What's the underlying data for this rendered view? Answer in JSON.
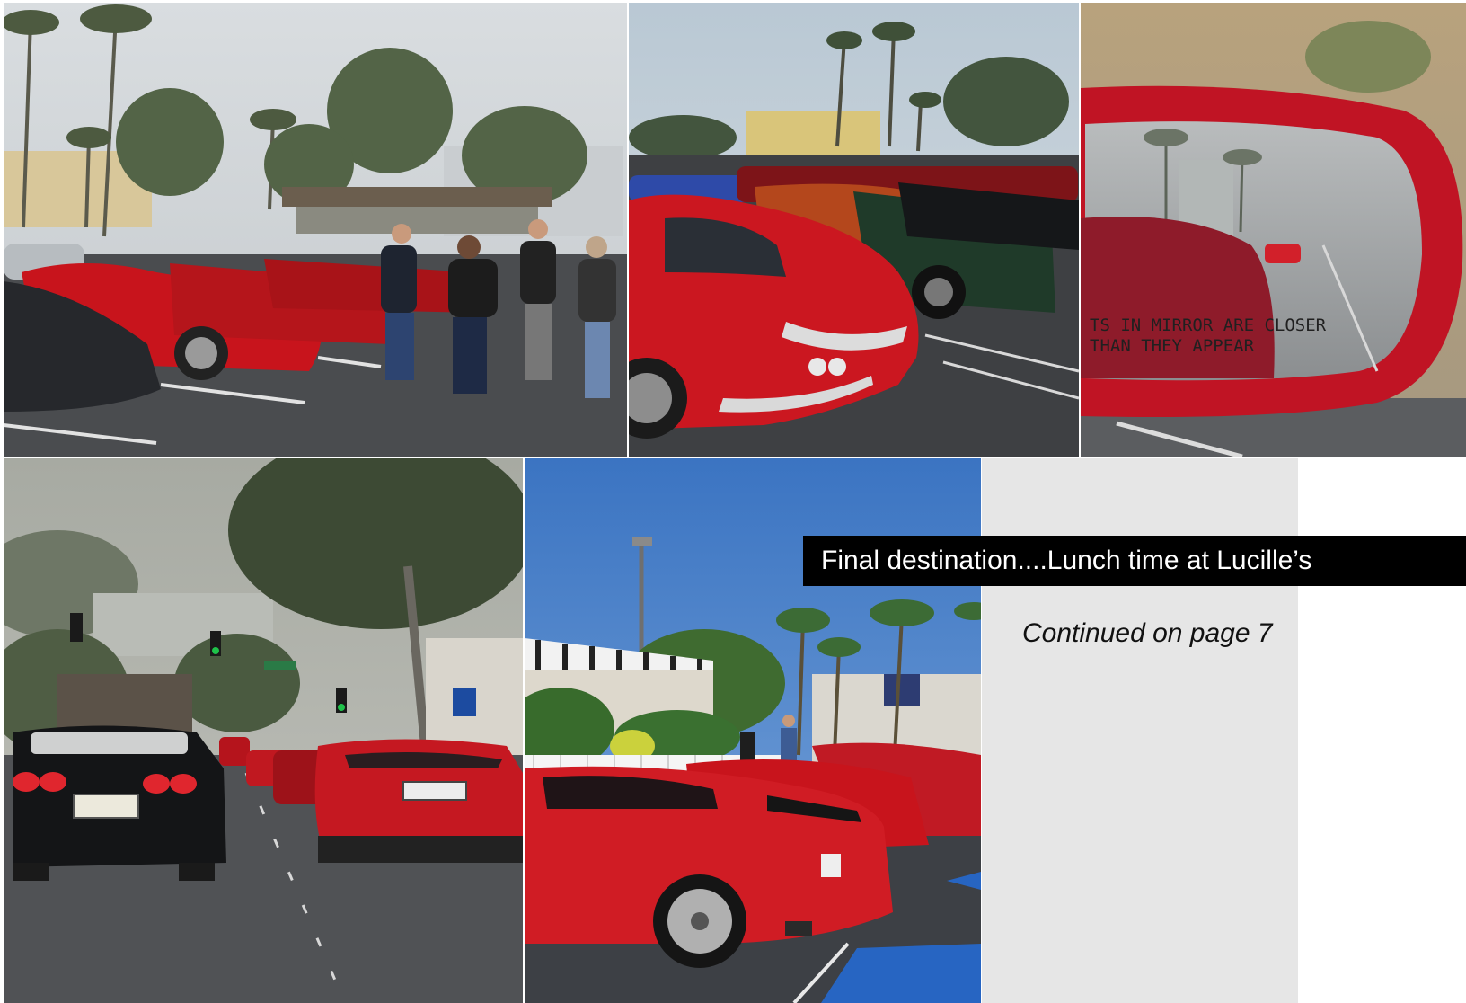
{
  "caption": {
    "title": "Final destination....Lunch time at Lucille’s",
    "note": "Continued on page 7"
  },
  "photos": {
    "mirror_text_line1": "TS IN MIRROR ARE CLOSER",
    "mirror_text_line2": "THAN THEY APPEAR"
  },
  "colors": {
    "corvette_red": "#c8141c",
    "caption_bar": "#000000",
    "side_panel": "#e6e6e6"
  }
}
